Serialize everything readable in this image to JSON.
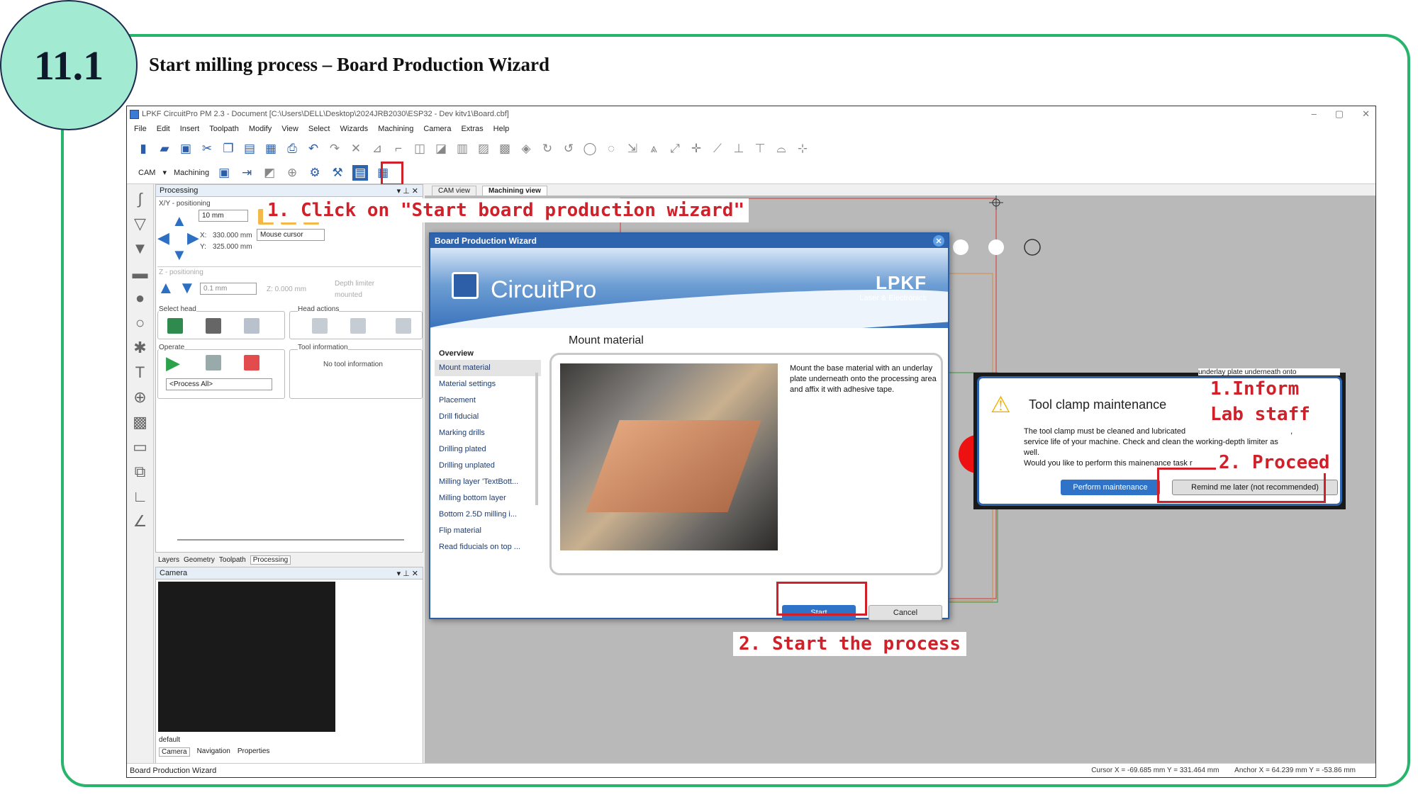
{
  "slide": {
    "step_number": "11.1",
    "title": "Start milling process – Board Production Wizard"
  },
  "app": {
    "window_title": "LPKF CircuitPro PM 2.3 - Document [C:\\Users\\DELL\\Desktop\\2024JRB2030\\ESP32 - Dev kitv1\\Board.cbf]",
    "menu": [
      "File",
      "Edit",
      "Insert",
      "Toolpath",
      "Modify",
      "View",
      "Select",
      "Wizards",
      "Machining",
      "Camera",
      "Extras",
      "Help"
    ],
    "toolbar2": {
      "cam_label": "CAM",
      "machining_label": "Machining"
    },
    "processing": {
      "title": "Processing",
      "xy_label": "X/Y - positioning",
      "step_value": "10 mm",
      "x_label": "X:",
      "x_value": "330.000 mm",
      "y_label": "Y:",
      "y_value": "325.000 mm",
      "mouse_cursor_label": "Mouse cursor",
      "z_label": "Z - positioning",
      "z_step": "0.1 mm",
      "z_value": "Z:  0.000 mm",
      "depth_limiter": "Depth limiter",
      "depth_state": "mounted",
      "select_head": "Select head",
      "head_actions": "Head actions",
      "operate": "Operate",
      "tool_information": "Tool information",
      "no_tool": "No tool information",
      "process_all": "<Process All>"
    },
    "panel_tabs": [
      "Layers",
      "Geometry",
      "Toolpath",
      "Processing"
    ],
    "camera": {
      "title": "Camera",
      "default_label": "default",
      "tabs": [
        "Camera",
        "Navigation",
        "Properties"
      ]
    },
    "view_tabs": [
      "CAM view",
      "Machining view"
    ],
    "status": {
      "left": "Board Production Wizard",
      "cursor": "Cursor X =  -69.685 mm   Y =  331.464 mm",
      "anchor": "Anchor X =  64.239 mm   Y =  -53.86 mm"
    },
    "colors": {
      "accent_blue": "#2e63ad",
      "annotation_red": "#d0202a",
      "frame_green": "#26b56b",
      "circle_fill": "#a3ead3"
    }
  },
  "wizard": {
    "title": "Board Production Wizard",
    "brand": "CircuitPro",
    "logo": "LPKF",
    "logo_sub": "Laser & Electronics",
    "nav_header": "Overview",
    "nav_items": [
      "Mount material",
      "Material settings",
      "Placement",
      "Drill fiducial",
      "Marking drills",
      "Drilling plated",
      "Drilling unplated",
      "Milling layer 'TextBott...",
      "Milling bottom layer",
      "Bottom 2.5D milling i...",
      "Flip material",
      "Read fiducials on top ..."
    ],
    "heading": "Mount material",
    "description": "Mount the base material with an underlay plate underneath onto the processing area and affix it with adhesive tape.",
    "start_label": "Start",
    "cancel_label": "Cancel"
  },
  "tool_clamp": {
    "title": "Tool clamp maintenance",
    "body_line1": "The tool clamp must be cleaned and lubricated",
    "body_line1_tail": ",",
    "body_line2": "service life of your machine. Check and clean the working-depth limiter as",
    "body_line3": "well.",
    "body_line4": "Would you like to perform this mainenance task r",
    "perform_label": "Perform maintenance",
    "remind_label": "Remind me later (not recommended)",
    "top_cut_text": "underlay plate underneath onto"
  },
  "annotations": {
    "click_wizard": "1. Click on \"Start board production wizard\"",
    "start_process": "2. Start the process",
    "inform_line1": "1.Inform",
    "inform_line2": "Lab staff",
    "proceed": "2. Proceed"
  }
}
